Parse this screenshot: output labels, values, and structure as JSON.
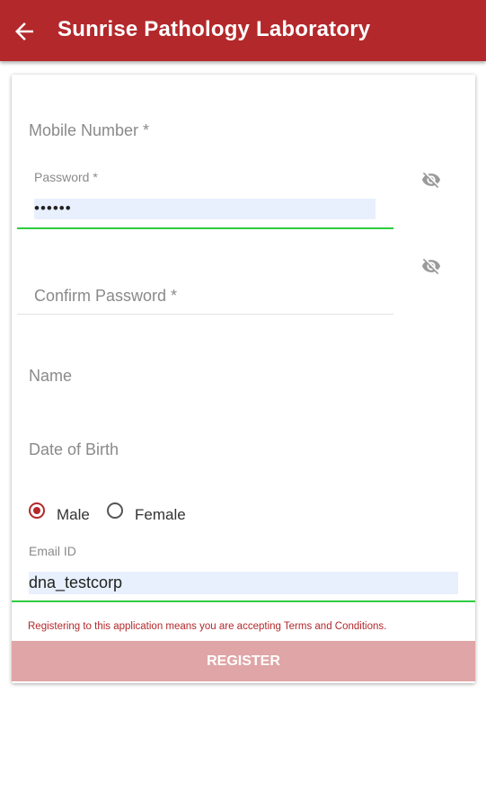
{
  "header": {
    "title": "Sunrise Pathology Laboratory",
    "back_icon": "arrow-left-icon"
  },
  "form": {
    "mobile": {
      "placeholder": "Mobile Number *",
      "value": ""
    },
    "password": {
      "label": "Password *",
      "value": "••••••",
      "toggle_icon": "eye-off-icon"
    },
    "confirm_password": {
      "placeholder": "Confirm Password *",
      "value": "",
      "toggle_icon": "eye-off-icon"
    },
    "name": {
      "placeholder": "Name",
      "value": ""
    },
    "dob": {
      "placeholder": "Date of Birth",
      "value": ""
    },
    "gender": {
      "options": [
        "Male",
        "Female"
      ],
      "selected": "Male"
    },
    "email": {
      "label": "Email ID",
      "value": "dna_testcorp"
    },
    "terms_text": "Registering to this application means you are accepting Terms and Conditions.",
    "register_label": "REGISTER"
  },
  "colors": {
    "primary": "#b3282b",
    "focus_line": "#2ecc40",
    "autofill_bg": "#e8f0fe",
    "button_disabled": "#e0a5a6"
  }
}
